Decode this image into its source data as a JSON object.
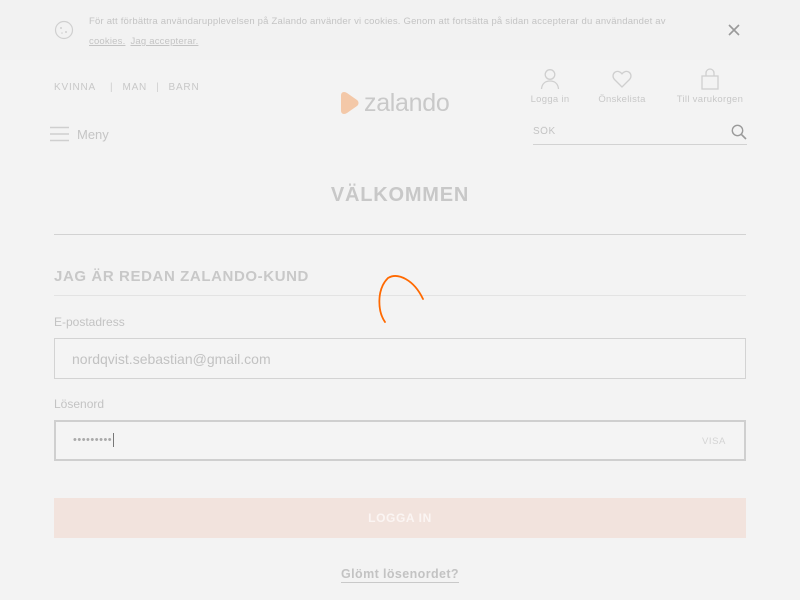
{
  "cookie_banner": {
    "text": "För att förbättra användarupplevelsen på Zalando använder vi cookies. Genom att fortsätta på sidan accepterar du användandet av ",
    "cookies_link": "cookies.",
    "accept_link": "Jag accepterar."
  },
  "header": {
    "gender_nav": [
      "KVINNA",
      "MAN",
      "BARN"
    ],
    "logo_text": "zalando",
    "actions": {
      "login": "Logga in",
      "wishlist": "Önskelista",
      "cart": "Till varukorgen"
    },
    "menu_label": "Meny",
    "search_placeholder": "SÖK"
  },
  "main": {
    "welcome_title": "VÄLKOMMEN",
    "section_title": "JAG ÄR REDAN ZALANDO-KUND",
    "email_label": "E-postadress",
    "email_value": "nordqvist.sebastian@gmail.com",
    "password_label": "Lösenord",
    "password_mask": "•••••••••",
    "show_password_label": "VISA",
    "login_button": "LOGGA IN",
    "forgot_password": "Glömt lösenordet?"
  },
  "colors": {
    "brand_orange": "#ff6900",
    "login_button_bg": "#f2e3dd",
    "overlay_bg": "#f3f3f3"
  }
}
